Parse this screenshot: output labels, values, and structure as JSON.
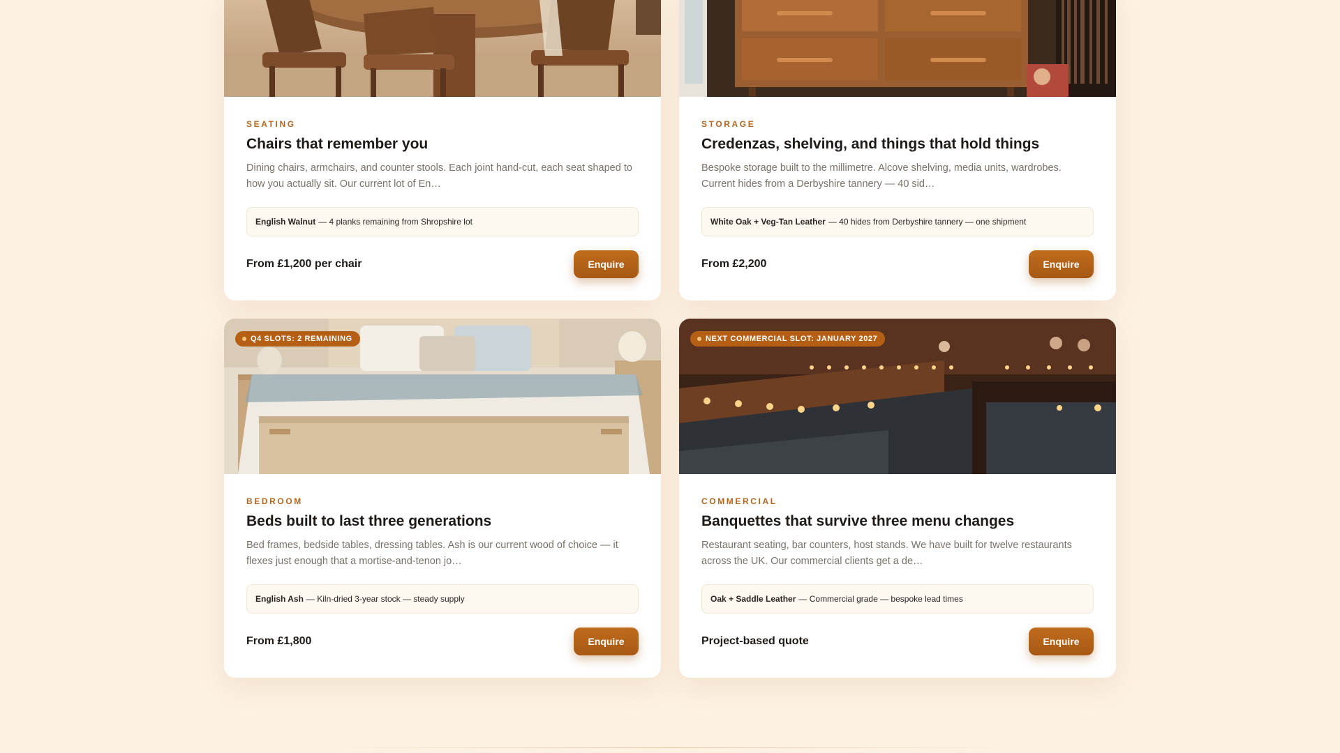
{
  "cards": [
    {
      "image": "dining-room-photo",
      "category": "Seating",
      "title": "Chairs that remember you",
      "description": "Dining chairs, armchairs, and counter stools. Each joint hand-cut, each seat shaped to how you actually sit. Our current lot of En…",
      "stock_material": "English Walnut",
      "stock_detail": "— 4 planks remaining from Shropshire lot",
      "price": "From £1,200 per chair",
      "button": "Enquire"
    },
    {
      "image": "credenza-photo",
      "category": "Storage",
      "title": "Credenzas, shelving, and things that hold things",
      "description": "Bespoke storage built to the millimetre. Alcove shelving, media units, wardrobes. Current hides from a Derbyshire tannery — 40 sid…",
      "stock_material": "White Oak + Veg-Tan Leather",
      "stock_detail": "— 40 hides from Derbyshire tannery — one shipment",
      "price": "From £2,200",
      "button": "Enquire"
    },
    {
      "image": "bedroom-photo",
      "badge": "Q4 SLOTS: 2 REMAINING",
      "category": "Bedroom",
      "title": "Beds built to last three generations",
      "description": "Bed frames, bedside tables, dressing tables. Ash is our current wood of choice — it flexes just enough that a mortise-and-tenon jo…",
      "stock_material": "English Ash",
      "stock_detail": "— Kiln-dried 3-year stock — steady supply",
      "price": "From £1,800",
      "button": "Enquire"
    },
    {
      "image": "restaurant-banquette-photo",
      "badge": "NEXT COMMERCIAL SLOT: JANUARY 2027",
      "category": "Commercial",
      "title": "Banquettes that survive three menu changes",
      "description": "Restaurant seating, bar counters, host stands. We have built for twelve restaurants across the UK. Our commercial clients get a de…",
      "stock_material": "Oak + Saddle Leather",
      "stock_detail": "— Commercial grade — bespoke lead times",
      "price": "Project-based quote",
      "button": "Enquire"
    }
  ],
  "colors": {
    "page_bg": "#fdf1e3",
    "accent": "#b4651d",
    "button": "#b15f17"
  }
}
